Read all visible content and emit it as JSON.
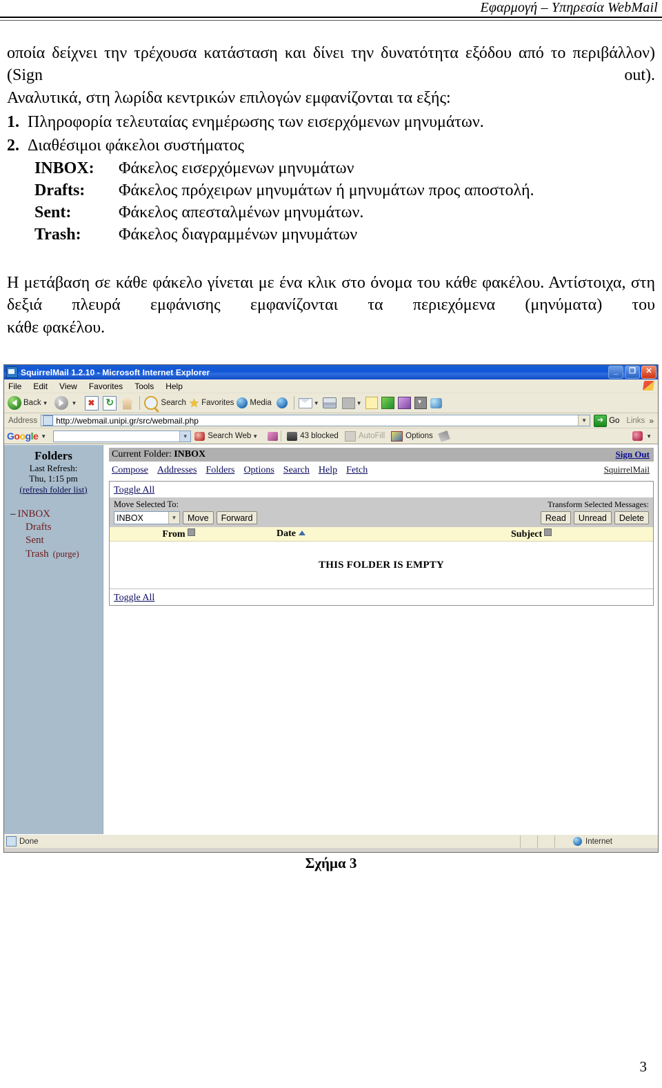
{
  "header": {
    "running_title": "Εφαρμογή – Υπηρεσία WebMail"
  },
  "body": {
    "para1": "οποία δείχνει την τρέχουσα κατάσταση και δίνει την δυνατότητα εξόδου από το περιβάλλον) (Sign out).",
    "para2": "Αναλυτικά, στη λωρίδα κεντρικών επιλογών εμφανίζονται τα εξής:",
    "item1_num": "1.",
    "item1_text": "Πληροφορία τελευταίας ενημέρωσης των εισερχόμενων μηνυμάτων.",
    "item2_num": "2.",
    "item2_text": "Διαθέσιμοι φάκελοι συστήματος",
    "folder_defs": [
      {
        "name": "INBOX:",
        "desc": "Φάκελος εισερχόμενων μηνυμάτων"
      },
      {
        "name": "Drafts:",
        "desc": "Φάκελος πρόχειρων μηνυμάτων ή μηνυμάτων προς αποστολή."
      },
      {
        "name": "Sent:",
        "desc": "Φάκελος απεσταλμένων μηνυμάτων."
      },
      {
        "name": "Trash:",
        "desc": "Φάκελος διαγραμμένων μηνυμάτων"
      }
    ],
    "para3": "Η μετάβαση σε κάθε φάκελο γίνεται με ένα κλικ στο όνομα του κάθε φακέλου. Αντίστοιχα, στη δεξιά πλευρά εμφάνισης εμφανίζονται τα περιεχόμενα (μηνύματα) του",
    "para4": "κάθε φακέλου."
  },
  "figure": {
    "caption": "Σχήμα 3",
    "page_number": "3"
  },
  "browser": {
    "title": "SquirrelMail 1.2.10 - Microsoft Internet Explorer",
    "window_buttons": {
      "minimize": "_",
      "restore": "❐",
      "close": "✕"
    },
    "menu": [
      "File",
      "Edit",
      "View",
      "Favorites",
      "Tools",
      "Help"
    ],
    "toolbar": {
      "back": "Back",
      "search": "Search",
      "favorites": "Favorites",
      "media": "Media",
      "icons": [
        "back-icon",
        "forward-icon",
        "stop-icon",
        "refresh-icon",
        "home-icon",
        "search-icon",
        "favorites-icon",
        "media-icon",
        "history-icon",
        "mail-icon",
        "print-icon",
        "edit-icon",
        "notes-icon",
        "messenger-icon",
        "research-icon",
        "inbox-icon",
        "people-icon"
      ]
    },
    "address": {
      "label": "Address",
      "url": "http://webmail.unipi.gr/src/webmail.php",
      "go": "Go",
      "links": "Links"
    },
    "google_toolbar": {
      "logo": "Google",
      "search_value": "",
      "search_web": "Search Web",
      "blocked": "43 blocked",
      "autofill": "AutoFill",
      "options": "Options"
    },
    "status": {
      "text": "Done",
      "zone": "Internet"
    }
  },
  "squirrelmail": {
    "sidebar": {
      "title": "Folders",
      "last_refresh_label": "Last Refresh:",
      "last_refresh_value": "Thu, 1:15 pm",
      "refresh_link": "(refresh folder list)",
      "folders": [
        {
          "label": "INBOX",
          "prefix": "–",
          "child": false,
          "extra": ""
        },
        {
          "label": "Drafts",
          "prefix": "",
          "child": true,
          "extra": ""
        },
        {
          "label": "Sent",
          "prefix": "",
          "child": true,
          "extra": ""
        },
        {
          "label": "Trash",
          "prefix": "",
          "child": true,
          "extra": "(purge)"
        }
      ]
    },
    "current_folder_label": "Current Folder:",
    "current_folder_value": "INBOX",
    "sign_out": "Sign Out",
    "brand": "SquirrelMail",
    "menu_links": [
      "Compose",
      "Addresses",
      "Folders",
      "Options",
      "Search",
      "Help",
      "Fetch"
    ],
    "toggle_all_top": "Toggle All",
    "toggle_all_bottom": "Toggle All",
    "move_selected_label": "Move Selected To:",
    "move_select_value": "INBOX",
    "move_button": "Move",
    "forward_button": "Forward",
    "transform_label": "Transform Selected Messages:",
    "read_button": "Read",
    "unread_button": "Unread",
    "delete_button": "Delete",
    "columns": {
      "from": "From",
      "date": "Date",
      "subject": "Subject"
    },
    "empty_message": "THIS FOLDER IS EMPTY"
  }
}
